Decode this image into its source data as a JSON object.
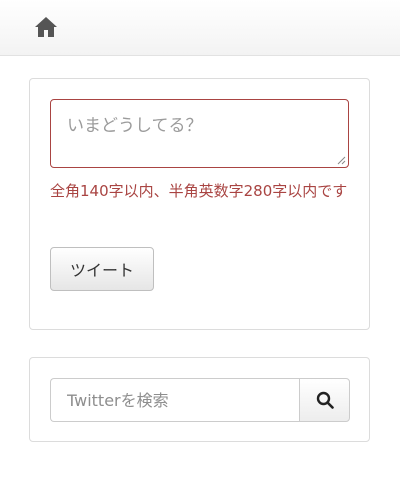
{
  "header": {
    "home_icon": "home-icon"
  },
  "compose": {
    "placeholder": "いまどうしてる？",
    "value": "",
    "error": "全角140字以内、半角英数字280字以内です",
    "tweet_label": "ツイート",
    "error_color": "#a94442"
  },
  "search": {
    "placeholder": "Twitterを検索",
    "value": "",
    "button_icon": "search-icon"
  }
}
